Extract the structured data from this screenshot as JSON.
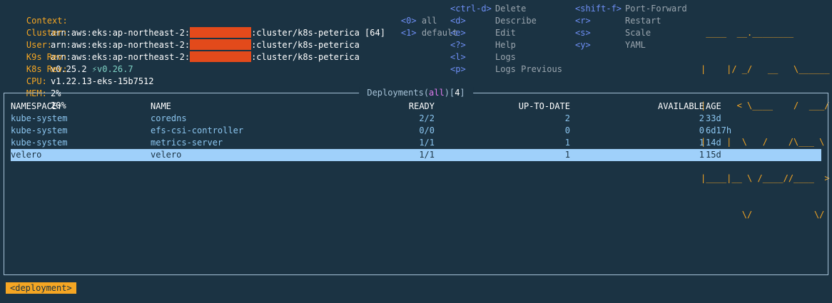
{
  "header": {
    "context_label": "Context:",
    "context_prefix": "arn:aws:eks:ap-northeast-2:",
    "context_suffix": ":cluster/k8s-peterica",
    "context_count": "[64]",
    "cluster_label": "Cluster:",
    "cluster_prefix": "arn:aws:eks:ap-northeast-2:",
    "cluster_suffix": ":cluster/k8s-peterica",
    "user_label": "User:",
    "user_prefix": "arn:aws:eks:ap-northeast-2:",
    "user_suffix": ":cluster/k8s-peterica",
    "k9s_rev_label": "K9s Rev:",
    "k9s_rev": "v0.25.2",
    "k9s_update": "⚡v0.26.7",
    "k8s_rev_label": "K8s Rev:",
    "k8s_rev": "v1.22.13-eks-15b7512",
    "cpu_label": "CPU:",
    "cpu": "2%",
    "mem_label": "MEM:",
    "mem": "20%",
    "redaction_color": "#e34a1b"
  },
  "namespaces": [
    {
      "key": "<0>",
      "label": "all"
    },
    {
      "key": "<1>",
      "label": "default"
    }
  ],
  "shortcuts_col1": [
    {
      "key": "<ctrl-d>",
      "label": "Delete"
    },
    {
      "key": "<d>",
      "label": "Describe"
    },
    {
      "key": "<e>",
      "label": "Edit"
    },
    {
      "key": "<?>",
      "label": "Help"
    },
    {
      "key": "<l>",
      "label": "Logs"
    },
    {
      "key": "<p>",
      "label": "Logs Previous"
    }
  ],
  "shortcuts_col2": [
    {
      "key": "<shift-f>",
      "label": "Port-Forward"
    },
    {
      "key": "<r>",
      "label": "Restart"
    },
    {
      "key": "<s>",
      "label": "Scale"
    },
    {
      "key": "<y>",
      "label": "YAML"
    }
  ],
  "logo_lines": [
    " ____  __.________",
    "|    |/ _/   __   \\______",
    "|      < \\____    /  ___/",
    "|    |  \\   /    /\\___ \\",
    "|____|__ \\ /____//____  >",
    "        \\/            \\/"
  ],
  "panel": {
    "title_prefix": " Deployments(",
    "title_ns": "all",
    "title_mid": ")[",
    "title_count": "4",
    "title_suffix": "] "
  },
  "table": {
    "columns": [
      "NAMESPACE↑",
      "NAME",
      "READY",
      "UP-TO-DATE",
      "AVAILABLE",
      "AGE"
    ],
    "rows": [
      {
        "namespace": "kube-system",
        "name": "coredns",
        "ready": "2/2",
        "uptodate": "2",
        "available": "2",
        "age": "33d"
      },
      {
        "namespace": "kube-system",
        "name": "efs-csi-controller",
        "ready": "0/0",
        "uptodate": "0",
        "available": "0",
        "age": "6d17h"
      },
      {
        "namespace": "kube-system",
        "name": "metrics-server",
        "ready": "1/1",
        "uptodate": "1",
        "available": "1",
        "age": "14d"
      },
      {
        "namespace": "velero",
        "name": "velero",
        "ready": "1/1",
        "uptodate": "1",
        "available": "1",
        "age": "15d"
      }
    ],
    "selected_index": 3
  },
  "footer": {
    "crumb": "<deployment>"
  },
  "colors": {
    "background": "#1b3343",
    "accent": "#f5a623",
    "key": "#6e8ff5",
    "row": "#8cc6f0",
    "selected_row": "#9fd0fa"
  }
}
